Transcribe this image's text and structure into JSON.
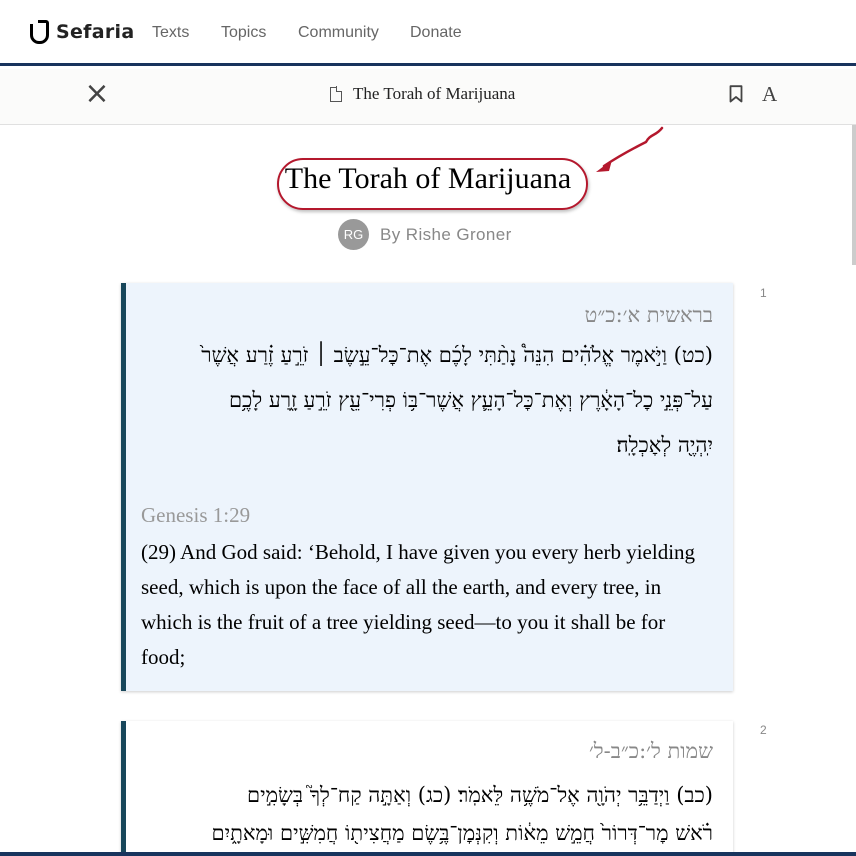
{
  "nav": {
    "logo": "Sefaria",
    "links": [
      "Texts",
      "Topics",
      "Community",
      "Donate"
    ]
  },
  "sheet_header": {
    "title": "The Torah of Marijuana",
    "font_button": "A",
    "close_glyph": "×"
  },
  "sheet": {
    "title": "The Torah of Marijuana",
    "author_initials": "RG",
    "author": "By Rishe Groner"
  },
  "sources": [
    {
      "number": "1",
      "he_ref": "בראשית א׳:כ״ט",
      "he_lines": [
        "(כט) וַיֹּ֣אמֶר אֱלֹהִ֗ים הִנֵּה֩ נָתַ֨תִּי לָכֶ֜ם אֶת־כׇּל־עֵ֣שֶׂב ׀ זֹרֵ֣עַ זֶ֗רַע אֲשֶׁר֙",
        "עַל־פְּנֵ֣י כׇל־הָאָ֔רֶץ וְאֶת־כׇּל־הָעֵ֛ץ אֲשֶׁר־בּ֥וֹ פְרִי־עֵ֖ץ זֹרֵ֣עַ זָ֑רַע לָכֶ֥ם",
        "יִֽהְיֶ֖ה לְאׇכְלָֽה׃"
      ],
      "en_ref": "Genesis 1:29",
      "en_lines": [
        "(29) And God said: ‘Behold, I have given you every herb yielding",
        "seed, which is upon the face of all the earth, and every tree, in",
        "which is the fruit of a tree yielding seed—to you it shall be for",
        "food;"
      ]
    },
    {
      "number": "2",
      "he_ref": "שמות ל׳:כ״ב-ל׳",
      "he_lines": [
        "(כב) וַיְדַבֵּ֥ר יְהֹוָ֖ה אֶל־מֹשֶׁ֥ה לֵּאמֹֽר׃ (כג) וְאַתָּ֣ה קַח־לְךָ֮ בְּשָׂמִ֣ים",
        "רֹ֗אשׁ מׇר־דְּרוֹר֙ חֲמֵ֣שׁ מֵא֔וֹת וְקִנְּמׇן־בֶּ֥שֶׂם מַחֲצִית֖וֹ חֲמִשִּׁ֣ים וּמָאתָ֑יִם"
      ]
    }
  ],
  "colors": {
    "accent_navy": "#18345d",
    "card_border": "#18475b",
    "card_bg": "#edf4fc",
    "annotation_red": "#b4182d"
  }
}
